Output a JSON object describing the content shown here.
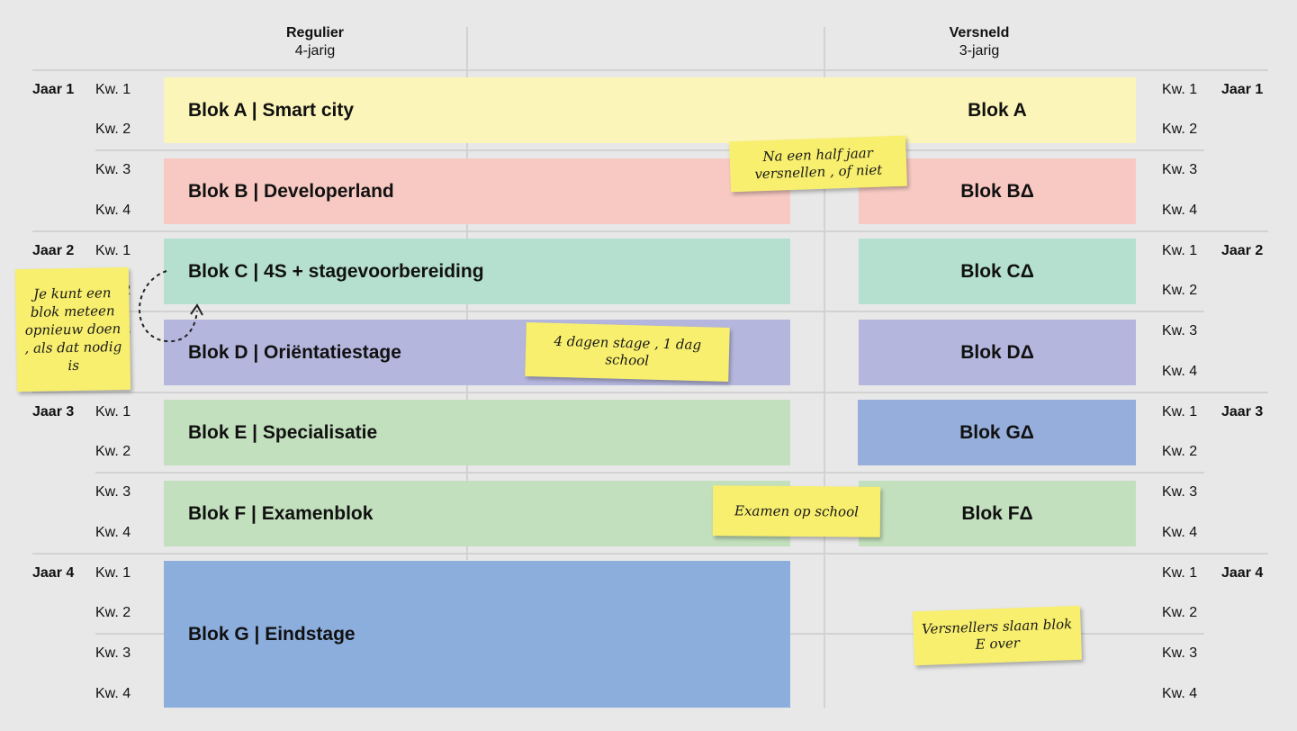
{
  "columns": {
    "regulier": {
      "title": "Regulier",
      "subtitle": "4-jarig"
    },
    "versneld": {
      "title": "Versneld",
      "subtitle": "3-jarig"
    }
  },
  "years": [
    "Jaar 1",
    "Jaar 2",
    "Jaar 3",
    "Jaar 4"
  ],
  "quarters": [
    "Kw. 1",
    "Kw. 2",
    "Kw. 3",
    "Kw. 4"
  ],
  "regulier_blocks": [
    {
      "label": "Blok A | Smart city",
      "color": "#fbf5b9"
    },
    {
      "label": "Blok B | Developerland",
      "color": "#f8c9c3"
    },
    {
      "label": "Blok C | 4S + stagevoorbereiding",
      "color": "#b5e0cf"
    },
    {
      "label": "Blok D | Oriëntatiestage",
      "color": "#b5b6de"
    },
    {
      "label": "Blok E | Specialisatie",
      "color": "#c2e0bd"
    },
    {
      "label": "Blok F | Examenblok",
      "color": "#c2e0bd"
    },
    {
      "label": "Blok G | Eindstage",
      "color": "#8caedd"
    }
  ],
  "versneld_blocks": [
    {
      "label": "Blok A",
      "color": "#fbf5b9"
    },
    {
      "label": "Blok BΔ",
      "color": "#f8c9c3"
    },
    {
      "label": "Blok CΔ",
      "color": "#b5e0cf"
    },
    {
      "label": "Blok DΔ",
      "color": "#b5b6de"
    },
    {
      "label": "Blok GΔ",
      "color": "#95aedc"
    },
    {
      "label": "Blok FΔ",
      "color": "#c2e0bd"
    }
  ],
  "notes": {
    "halfjaar": "Na een half jaar versnellen , of niet",
    "opnieuw": "Je kunt een blok meteen opnieuw doen , als dat nodig is",
    "stage": "4 dagen stage , 1 dag school",
    "examen": "Examen op school",
    "versnellers": "Versnellers slaan blok E over"
  }
}
